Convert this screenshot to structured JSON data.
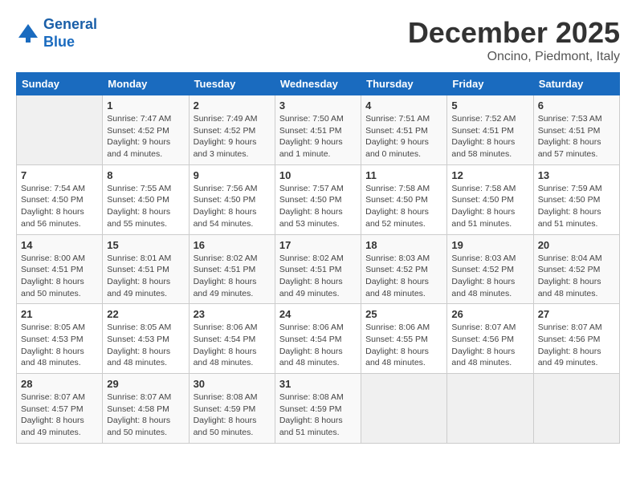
{
  "header": {
    "logo": {
      "line1": "General",
      "line2": "Blue"
    },
    "title": "December 2025",
    "subtitle": "Oncino, Piedmont, Italy"
  },
  "days_of_week": [
    "Sunday",
    "Monday",
    "Tuesday",
    "Wednesday",
    "Thursday",
    "Friday",
    "Saturday"
  ],
  "weeks": [
    [
      {
        "day": "",
        "info": ""
      },
      {
        "day": "1",
        "info": "Sunrise: 7:47 AM\nSunset: 4:52 PM\nDaylight: 9 hours\nand 4 minutes."
      },
      {
        "day": "2",
        "info": "Sunrise: 7:49 AM\nSunset: 4:52 PM\nDaylight: 9 hours\nand 3 minutes."
      },
      {
        "day": "3",
        "info": "Sunrise: 7:50 AM\nSunset: 4:51 PM\nDaylight: 9 hours\nand 1 minute."
      },
      {
        "day": "4",
        "info": "Sunrise: 7:51 AM\nSunset: 4:51 PM\nDaylight: 9 hours\nand 0 minutes."
      },
      {
        "day": "5",
        "info": "Sunrise: 7:52 AM\nSunset: 4:51 PM\nDaylight: 8 hours\nand 58 minutes."
      },
      {
        "day": "6",
        "info": "Sunrise: 7:53 AM\nSunset: 4:51 PM\nDaylight: 8 hours\nand 57 minutes."
      }
    ],
    [
      {
        "day": "7",
        "info": "Sunrise: 7:54 AM\nSunset: 4:50 PM\nDaylight: 8 hours\nand 56 minutes."
      },
      {
        "day": "8",
        "info": "Sunrise: 7:55 AM\nSunset: 4:50 PM\nDaylight: 8 hours\nand 55 minutes."
      },
      {
        "day": "9",
        "info": "Sunrise: 7:56 AM\nSunset: 4:50 PM\nDaylight: 8 hours\nand 54 minutes."
      },
      {
        "day": "10",
        "info": "Sunrise: 7:57 AM\nSunset: 4:50 PM\nDaylight: 8 hours\nand 53 minutes."
      },
      {
        "day": "11",
        "info": "Sunrise: 7:58 AM\nSunset: 4:50 PM\nDaylight: 8 hours\nand 52 minutes."
      },
      {
        "day": "12",
        "info": "Sunrise: 7:58 AM\nSunset: 4:50 PM\nDaylight: 8 hours\nand 51 minutes."
      },
      {
        "day": "13",
        "info": "Sunrise: 7:59 AM\nSunset: 4:50 PM\nDaylight: 8 hours\nand 51 minutes."
      }
    ],
    [
      {
        "day": "14",
        "info": "Sunrise: 8:00 AM\nSunset: 4:51 PM\nDaylight: 8 hours\nand 50 minutes."
      },
      {
        "day": "15",
        "info": "Sunrise: 8:01 AM\nSunset: 4:51 PM\nDaylight: 8 hours\nand 49 minutes."
      },
      {
        "day": "16",
        "info": "Sunrise: 8:02 AM\nSunset: 4:51 PM\nDaylight: 8 hours\nand 49 minutes."
      },
      {
        "day": "17",
        "info": "Sunrise: 8:02 AM\nSunset: 4:51 PM\nDaylight: 8 hours\nand 49 minutes."
      },
      {
        "day": "18",
        "info": "Sunrise: 8:03 AM\nSunset: 4:52 PM\nDaylight: 8 hours\nand 48 minutes."
      },
      {
        "day": "19",
        "info": "Sunrise: 8:03 AM\nSunset: 4:52 PM\nDaylight: 8 hours\nand 48 minutes."
      },
      {
        "day": "20",
        "info": "Sunrise: 8:04 AM\nSunset: 4:52 PM\nDaylight: 8 hours\nand 48 minutes."
      }
    ],
    [
      {
        "day": "21",
        "info": "Sunrise: 8:05 AM\nSunset: 4:53 PM\nDaylight: 8 hours\nand 48 minutes."
      },
      {
        "day": "22",
        "info": "Sunrise: 8:05 AM\nSunset: 4:53 PM\nDaylight: 8 hours\nand 48 minutes."
      },
      {
        "day": "23",
        "info": "Sunrise: 8:06 AM\nSunset: 4:54 PM\nDaylight: 8 hours\nand 48 minutes."
      },
      {
        "day": "24",
        "info": "Sunrise: 8:06 AM\nSunset: 4:54 PM\nDaylight: 8 hours\nand 48 minutes."
      },
      {
        "day": "25",
        "info": "Sunrise: 8:06 AM\nSunset: 4:55 PM\nDaylight: 8 hours\nand 48 minutes."
      },
      {
        "day": "26",
        "info": "Sunrise: 8:07 AM\nSunset: 4:56 PM\nDaylight: 8 hours\nand 48 minutes."
      },
      {
        "day": "27",
        "info": "Sunrise: 8:07 AM\nSunset: 4:56 PM\nDaylight: 8 hours\nand 49 minutes."
      }
    ],
    [
      {
        "day": "28",
        "info": "Sunrise: 8:07 AM\nSunset: 4:57 PM\nDaylight: 8 hours\nand 49 minutes."
      },
      {
        "day": "29",
        "info": "Sunrise: 8:07 AM\nSunset: 4:58 PM\nDaylight: 8 hours\nand 50 minutes."
      },
      {
        "day": "30",
        "info": "Sunrise: 8:08 AM\nSunset: 4:59 PM\nDaylight: 8 hours\nand 50 minutes."
      },
      {
        "day": "31",
        "info": "Sunrise: 8:08 AM\nSunset: 4:59 PM\nDaylight: 8 hours\nand 51 minutes."
      },
      {
        "day": "",
        "info": ""
      },
      {
        "day": "",
        "info": ""
      },
      {
        "day": "",
        "info": ""
      }
    ]
  ]
}
